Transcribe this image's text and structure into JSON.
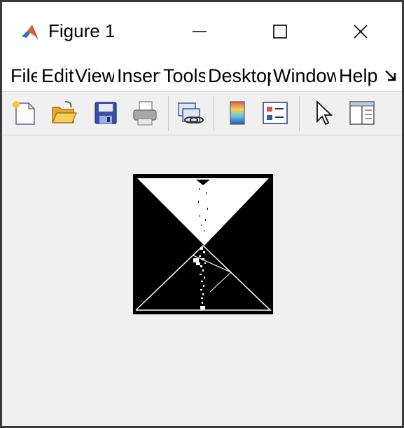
{
  "window": {
    "title": "Figure 1",
    "app_icon": "matlab-logo-icon",
    "controls": [
      "minimize-icon",
      "maximize-icon",
      "close-icon"
    ]
  },
  "menubar": {
    "items": [
      {
        "label": "File"
      },
      {
        "label": "Edit"
      },
      {
        "label": "View"
      },
      {
        "label": "Insert"
      },
      {
        "label": "Tools"
      },
      {
        "label": "Desktop"
      },
      {
        "label": "Window"
      },
      {
        "label": "Help"
      }
    ],
    "overflow_icon": "menu-overflow-arrow-icon"
  },
  "toolbar": {
    "tools": [
      "new-figure-icon",
      "open-file-icon",
      "save-icon",
      "print-icon",
      "link-plot-icon",
      "insert-colorbar-icon",
      "insert-legend-icon",
      "edit-plot-pointer-icon",
      "property-inspector-icon"
    ]
  },
  "figure": {
    "background": "#000000",
    "foreground": "#ffffff",
    "description_type": "binary-image"
  }
}
